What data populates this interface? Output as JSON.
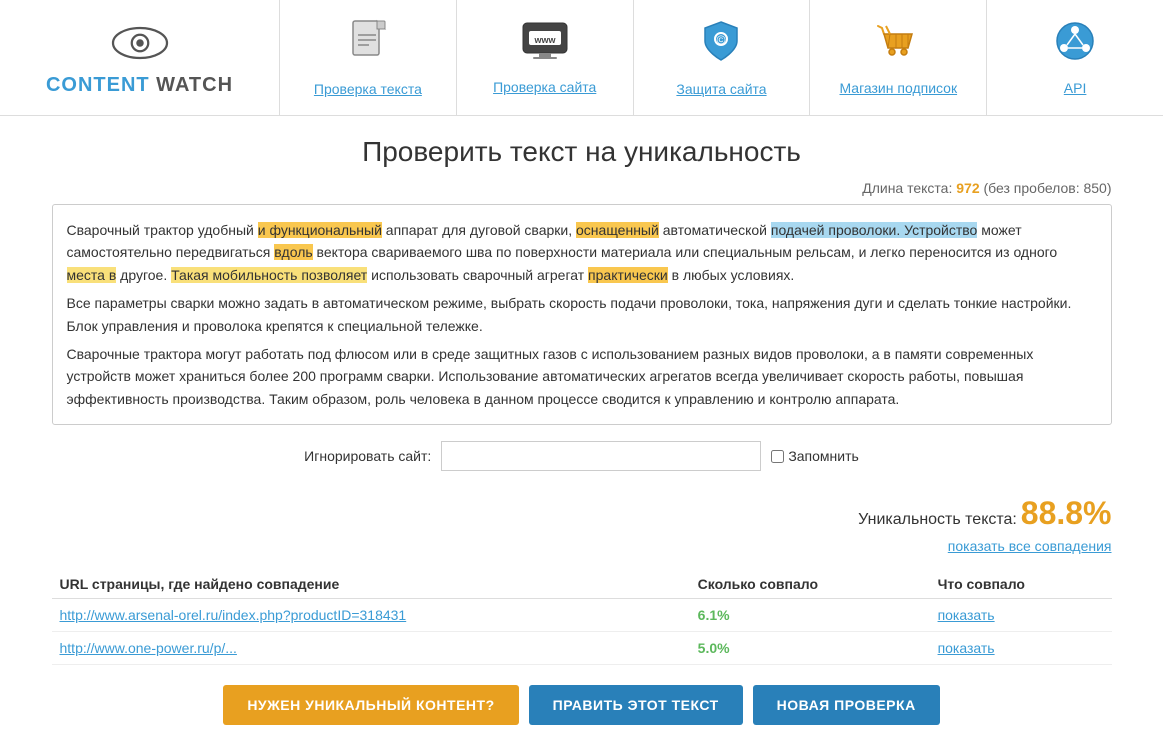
{
  "logo": {
    "text_content": "CONTENT WATCH",
    "text_cyan": "CONTENT",
    "text_gray": " WATCH"
  },
  "nav": {
    "items": [
      {
        "id": "check-text",
        "label": "Проверка текста",
        "icon": "document"
      },
      {
        "id": "check-site",
        "label": "Проверка сайта",
        "icon": "www"
      },
      {
        "id": "protect-site",
        "label": "Защита сайта",
        "icon": "shield"
      },
      {
        "id": "shop",
        "label": "Магазин подписок",
        "icon": "basket"
      },
      {
        "id": "api",
        "label": "API",
        "icon": "hub"
      }
    ]
  },
  "main": {
    "page_title": "Проверить текст на уникальность",
    "text_length_label": "Длина текста:",
    "text_length_value": "972",
    "text_no_spaces_label": "(без пробелов: 850)",
    "text_body": "Сварочный трактор удобный и функциональный аппарат для дуговой сварки, оснащенный автоматической подачей проволоки. Устройство может самостоятельно передвигаться вдоль вектора свариваемого шва по поверхности материала или специальным рельсам, и легко переносится из одного места в другое. Такая мобильность позволяет использовать сварочный агрегат практически в любых условиях.\nВсе параметры сварки можно задать в автоматическом режиме, выбрать скорость подачи проволоки, тока, напряжения дуги и сделать тонкие настройки. Блок управления и проволока крепятся к специальной тележке.\nСварочные трактора могут работать под флюсом или в среде защитных газов с использованием разных видов проволоки, а в памяти современных устройств может храниться более 200 программ сварки. Использование автоматических агрегатов всегда увеличивает скорость работы, повышая эффективность производства. Таким образом, роль человека в данном процессе сводится к управлению и контролю аппарата.",
    "ignore_site_label": "Игнорировать сайт:",
    "ignore_site_placeholder": "",
    "remember_label": "Запомнить",
    "uniqueness_label": "Уникальность текста:",
    "uniqueness_value": "88.8%",
    "show_all_link": "показать все совпадения",
    "table": {
      "col1": "URL страницы, где найдено совпадение",
      "col2": "Сколько совпало",
      "col3": "Что совпало",
      "rows": [
        {
          "url": "http://www.arsenal-orel.ru/index.php?productID=318431",
          "percent": "6.1%",
          "action": "показать"
        },
        {
          "url": "http://www.one-power.ru/p/...",
          "percent": "5.0%",
          "action": "показать"
        }
      ]
    },
    "buttons": {
      "need_content": "НУЖЕН УНИКАЛЬНЫЙ КОНТЕНТ?",
      "edit_text": "ПРАВИТЬ ЭТОТ ТЕКСТ",
      "new_check": "НОВАЯ ПРОВЕРКА"
    }
  }
}
